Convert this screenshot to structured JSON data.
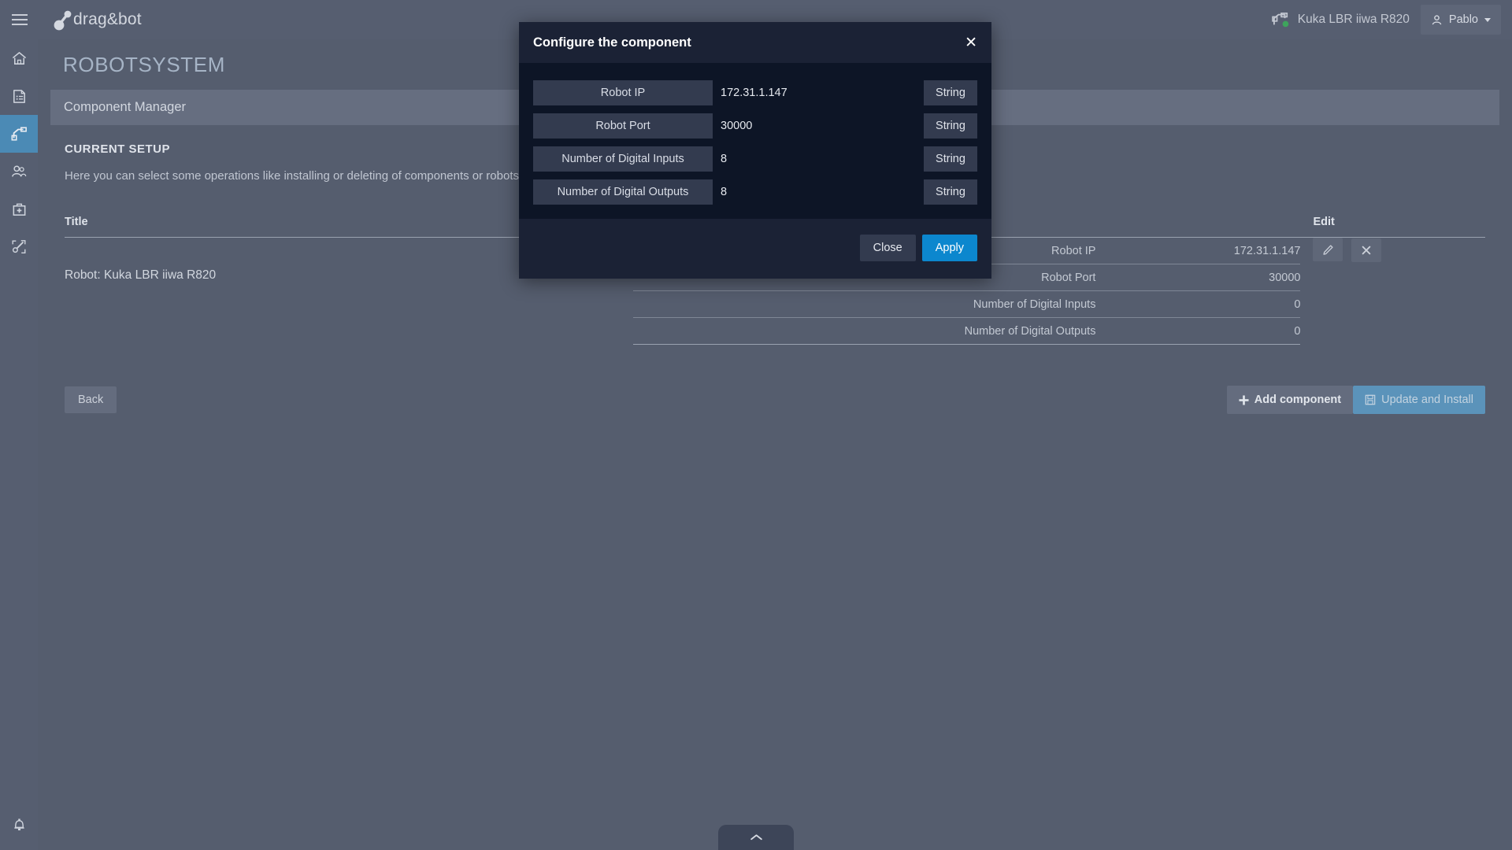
{
  "topbar": {
    "menu_icon": "hamburger-icon",
    "brand": "drag&bot",
    "robot_status_label": "Kuka LBR iiwa R820",
    "robot_status_icon": "robot-arm-icon",
    "user_name": "Pablo",
    "user_icon": "user-icon"
  },
  "sidebar": {
    "items": [
      {
        "name": "home",
        "icon": "home-icon"
      },
      {
        "name": "programs",
        "icon": "file-list-icon"
      },
      {
        "name": "robot",
        "icon": "robot-arm-icon",
        "active": true
      },
      {
        "name": "users",
        "icon": "users-icon"
      },
      {
        "name": "toolbox",
        "icon": "toolbox-plus-icon"
      },
      {
        "name": "calibration",
        "icon": "wrench-arrows-icon"
      }
    ],
    "bell_icon": "bell-icon"
  },
  "page": {
    "title": "ROBOTSYSTEM",
    "panel_header": "Component Manager",
    "section_title": "CURRENT SETUP",
    "section_desc": "Here you can select some operations like installing or deleting of components or robots. T"
  },
  "table": {
    "headers": {
      "title": "Title",
      "edit": "Edit"
    },
    "rows": [
      {
        "component": "Robot: Kuka LBR iiwa R820",
        "params": [
          {
            "name": "Robot IP",
            "value": "172.31.1.147"
          },
          {
            "name": "Robot Port",
            "value": "30000"
          },
          {
            "name": "Number of Digital Inputs",
            "value": "0"
          },
          {
            "name": "Number of Digital Outputs",
            "value": "0"
          }
        ],
        "actions": [
          {
            "name": "edit-row-button",
            "icon": "pencil-icon"
          },
          {
            "name": "delete-row-button",
            "icon": "close-x-icon"
          }
        ]
      }
    ]
  },
  "actions": {
    "back": "Back",
    "add_component": "Add component",
    "add_component_icon": "plus-icon",
    "update_install": "Update and Install",
    "update_install_icon": "save-disk-icon"
  },
  "drawer": {
    "icon": "chevron-up-icon"
  },
  "modal": {
    "title": "Configure the component",
    "close_icon": "close-x-icon",
    "fields": [
      {
        "label": "Robot IP",
        "value": "172.31.1.147",
        "type": "String"
      },
      {
        "label": "Robot Port",
        "value": "30000",
        "type": "String"
      },
      {
        "label": "Number of Digital Inputs",
        "value": "8",
        "type": "String"
      },
      {
        "label": "Number of Digital Outputs",
        "value": "8",
        "type": "String"
      }
    ],
    "close_label": "Close",
    "apply_label": "Apply"
  },
  "colors": {
    "chrome": "#565e70",
    "page_bg": "#555d6e",
    "accent_blue": "#4b8ab5",
    "apply_blue": "#0c87ce",
    "modal_bg": "#0d1526",
    "modal_head": "#1b2235",
    "status_green": "#3ea45c"
  }
}
